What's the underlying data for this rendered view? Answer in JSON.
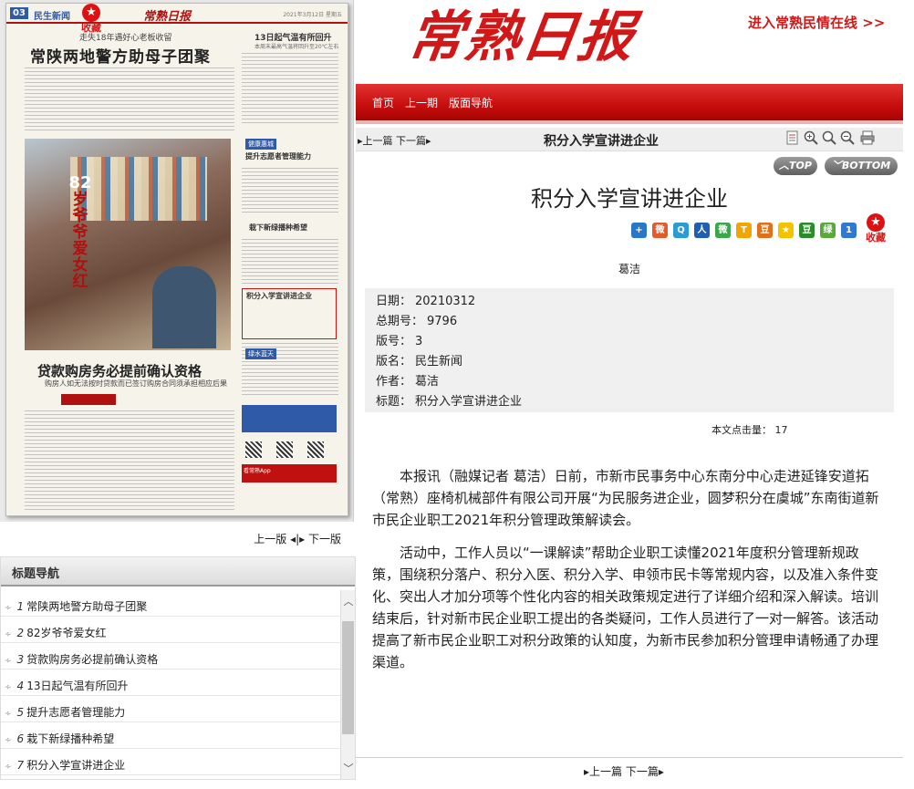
{
  "left": {
    "paper": {
      "page_no": "03",
      "section": "民生新闻",
      "masthead": "常熟日报",
      "date_line": "2021年3月12日 星期五",
      "fav_label": "收藏",
      "kicker": "走失18年遇好心老板收留",
      "headline1": "常陕两地警方助母子团聚",
      "headline2": "13日起气温有所回升",
      "sub2": "本周末最高气温将回升至20℃左右",
      "vertical_num": "82",
      "vertical_title": "岁爷爷爱女红",
      "headline3": "贷款购房务必提前确认资格",
      "sub3": "购房人如无法按时贷款而已签订购房合同须承担相应后果",
      "mid1": "提升志愿者管理能力",
      "mid2": "栽下新绿播种希望",
      "mid3": "积分入学宣讲进企业",
      "tag1": "健康惠城",
      "tag2": "绿水蓝天",
      "ad_text": "看常熟App"
    },
    "pager": {
      "prev": "上一版",
      "next": "下一版"
    },
    "nav": {
      "title": "标题导航",
      "items": [
        {
          "idx": "1",
          "label": "常陕两地警方助母子团聚"
        },
        {
          "idx": "2",
          "label": "82岁爷爷爱女红"
        },
        {
          "idx": "3",
          "label": "贷款购房务必提前确认资格"
        },
        {
          "idx": "4",
          "label": "13日起气温有所回升"
        },
        {
          "idx": "5",
          "label": "提升志愿者管理能力"
        },
        {
          "idx": "6",
          "label": "栽下新绿播种希望"
        },
        {
          "idx": "7",
          "label": "积分入学宣讲进企业"
        }
      ]
    }
  },
  "header": {
    "logo": "常熟日报",
    "promo": "进入常熟民情在线 >>",
    "nav": [
      "首页",
      "上一期",
      "版面导航"
    ]
  },
  "article_bar": {
    "prev_next": "▸上一篇 下一篇▸",
    "title": "积分入学宣讲进企业",
    "tools": [
      "list-icon",
      "zoom-in-icon",
      "zoom-reset-icon",
      "zoom-out-icon",
      "print-icon"
    ]
  },
  "pills": {
    "top": "TOP",
    "bottom": "BOTTOM"
  },
  "article": {
    "title": "积分入学宣讲进企业",
    "author": "葛洁",
    "fav_label": "收藏",
    "share_icons": [
      "share-plus-icon",
      "weibo-icon",
      "qzone-icon",
      "renren-icon",
      "wechat-icon",
      "tqq-icon",
      "douban-icon",
      "star-icon",
      "dou-icon",
      "green-icon",
      "number-icon"
    ],
    "meta": {
      "date_label": "日期：",
      "date": "20210312",
      "issue_label": "总期号：",
      "issue": "9796",
      "page_label": "版号：",
      "page": "3",
      "section_label": "版名：",
      "section": "民生新闻",
      "author_label": "作者：",
      "author": "葛洁",
      "title_label": "标题：",
      "title": "积分入学宣讲进企业"
    },
    "clicks_label": "本文点击量：",
    "clicks": "17",
    "paragraphs": [
      "本报讯（融媒记者 葛洁）日前，市新市民事务中心东南分中心走进延锋安道拓（常熟）座椅机械部件有限公司开展“为民服务进企业，圆梦积分在虞城”东南街道新市民企业职工2021年积分管理政策解读会。",
      "活动中，工作人员以“一课解读”帮助企业职工读懂2021年度积分管理新规政策，围绕积分落户、积分入医、积分入学、申领市民卡等常规内容，以及准入条件变化、突出人才加分项等个性化内容的相关政策规定进行了详细介绍和深入解读。培训结束后，针对新市民企业职工提出的各类疑问，工作人员进行了一对一解答。该活动提高了新市民企业职工对积分政策的认知度，为新市民参加积分管理申请畅通了办理渠道。"
    ],
    "bottom_pager": "▸上一篇 下一篇▸"
  },
  "colors": {
    "brand_red": "#d01818",
    "nav_red": "#c70d0d",
    "meta_bg": "#f0f0f0"
  }
}
